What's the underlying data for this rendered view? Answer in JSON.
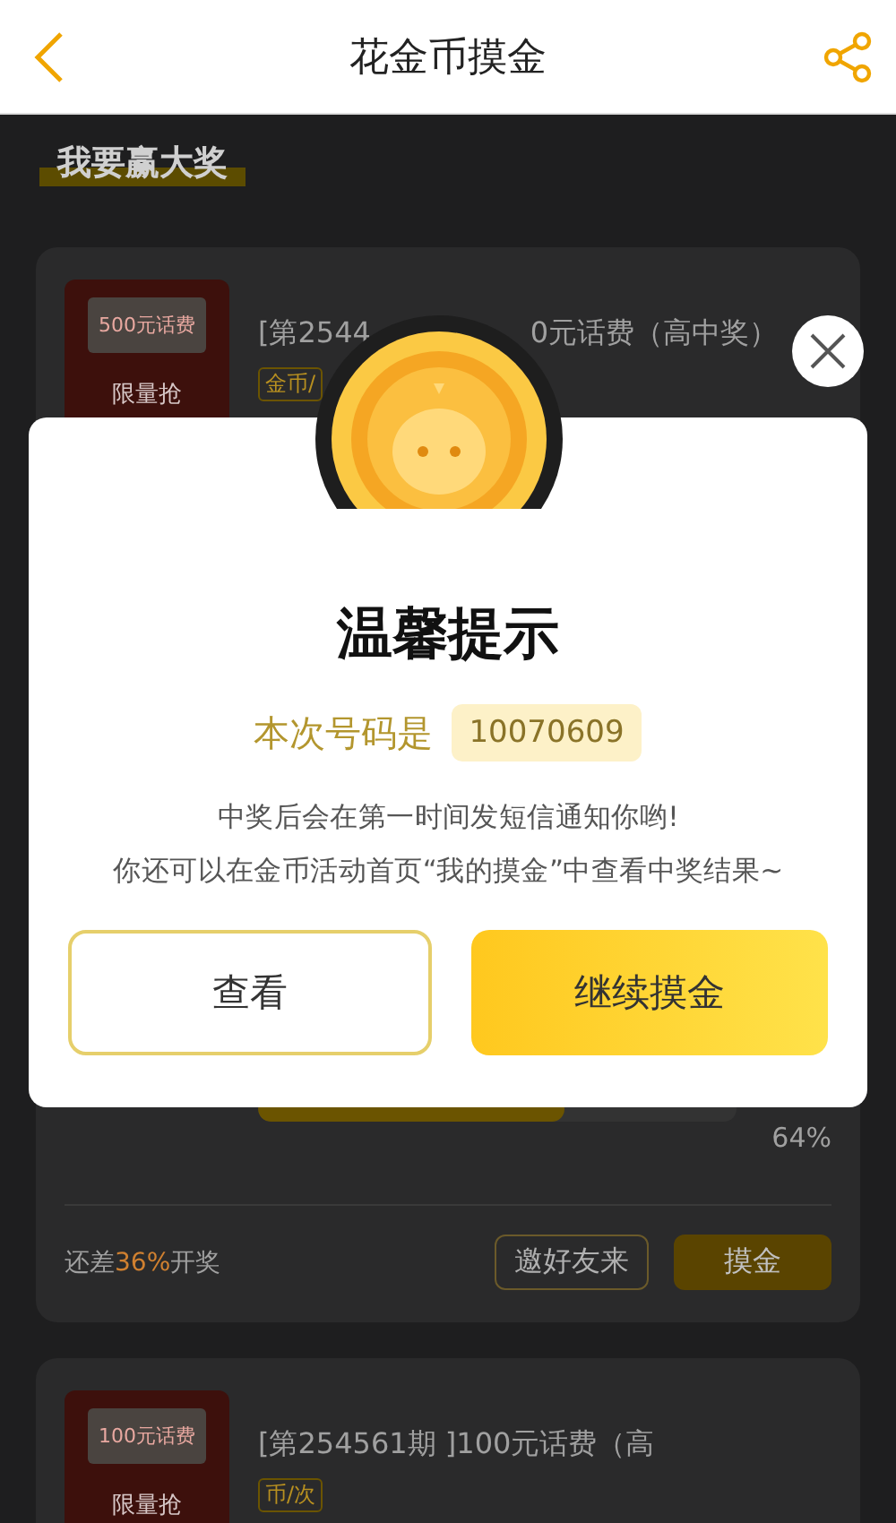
{
  "header": {
    "title": "花金币摸金"
  },
  "section_title": "我要赢大奖",
  "cards": [
    {
      "image_label": "500元话费",
      "image_badge": "限量抢",
      "title_parts": [
        "[第2544",
        "0元话费（高中奖）"
      ],
      "tag": "金币/",
      "level": 0.64,
      "percent": "64%",
      "remaining": "还差**36%**开奖",
      "invite_button": "邀好友来",
      "action_button": "摸金"
    },
    {
      "image_label": "100元话费",
      "image_badge": "限量抢",
      "title_parts": [
        "[第254561期 ]100元话费（高"
      ],
      "tag": "币/次"
    }
  ],
  "dialog": {
    "title": "温馨提示",
    "code_label": "本次号码是",
    "code": "10070609",
    "message_lines": [
      "中奖后会在第一时间发短信通知你哟!",
      "你还可以在金币活动首页“我的摸金”中查看中奖结果~"
    ],
    "buttons": [
      {
        "label": "查看",
        "kind": "outline"
      },
      {
        "label": "继续摸金",
        "kind": "primary"
      }
    ]
  }
}
